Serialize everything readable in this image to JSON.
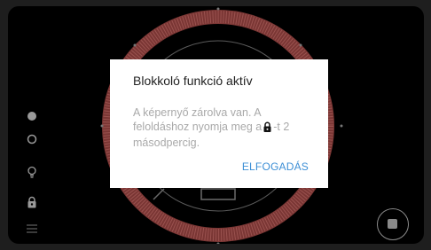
{
  "dialog": {
    "title": "Blokkoló funkció aktív",
    "message_before": "A képernyő zárolva van. A feloldáshoz nyomja meg a",
    "message_after": "-t 2 másodpercig.",
    "inline_icon": "lock-icon",
    "accept_label": "ELFOGADÁS"
  },
  "side_icons": [
    "filled-circle-icon",
    "hollow-circle-icon",
    "lightbulb-icon",
    "lock-icon",
    "menu-icon"
  ],
  "controls": {
    "stop_icon": "stop-icon"
  },
  "colors": {
    "ring": "#8a3a3a",
    "accent": "#3d8fd6",
    "panel": "#000000",
    "dialog": "#ffffff"
  }
}
